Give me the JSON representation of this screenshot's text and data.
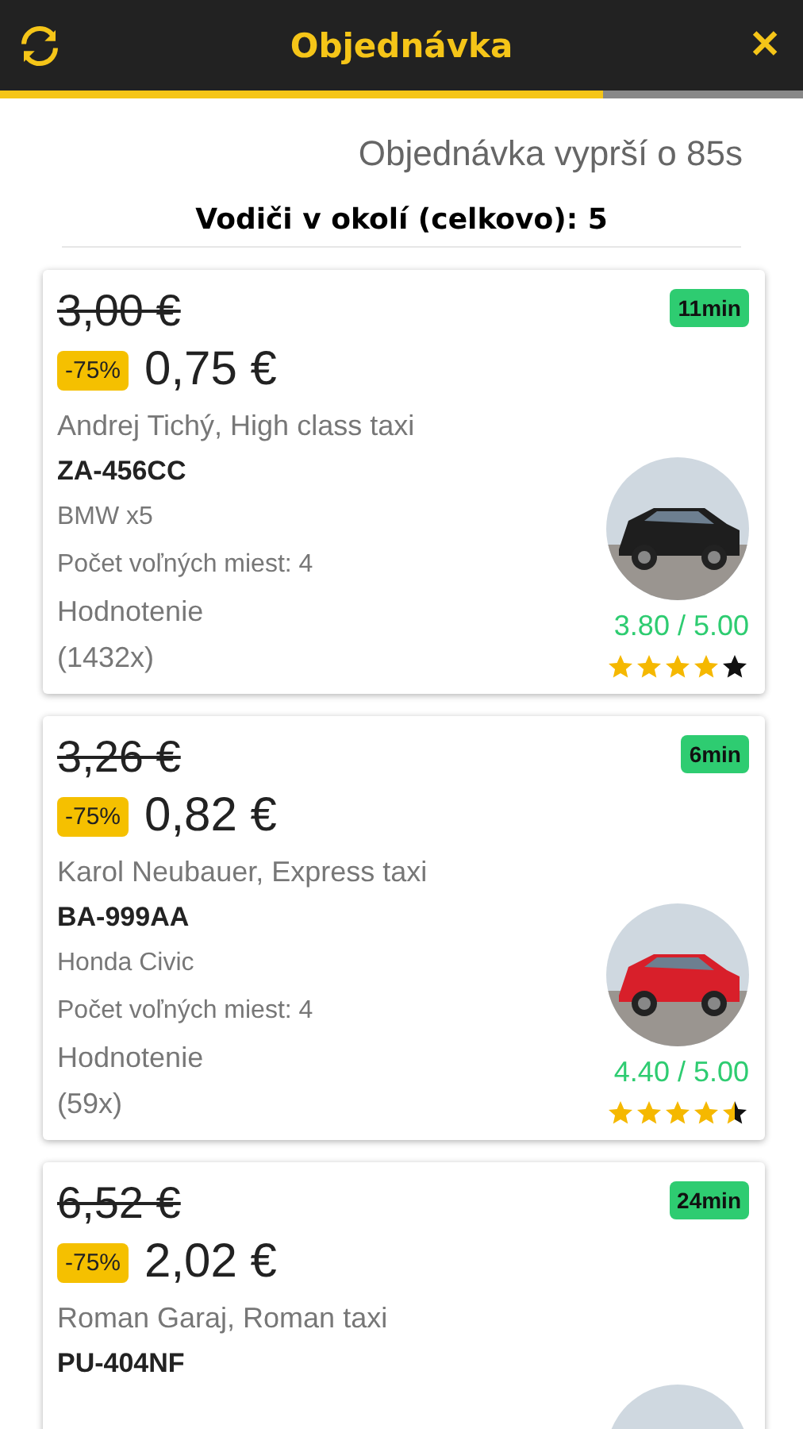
{
  "header": {
    "title": "Objednávka",
    "close": "✕",
    "progress": {
      "level": 0.75
    }
  },
  "expiry": "Objednávka vyprší o 85s",
  "drivers_heading": "Vodiči v okolí (celkovo): 5",
  "offers": [
    {
      "old_price": "3,00 €",
      "discount": "-75%",
      "price": "0,75 €",
      "eta": "11min",
      "driver": "Andrej Tichý, High class taxi",
      "plate": "ZA-456CC",
      "model": "BMW x5",
      "seats": "Počet voľných miest: 4",
      "rating_label": "Hodnotenie",
      "rating_count": "(1432x)",
      "rating": "3.80 / 5.00",
      "stars": 4
    },
    {
      "old_price": "3,26 €",
      "discount": "-75%",
      "price": "0,82 €",
      "eta": "6min",
      "driver": "Karol Neubauer, Express taxi",
      "plate": "BA-999AA",
      "model": "Honda Civic",
      "seats": "Počet voľných miest: 4",
      "rating_label": "Hodnotenie",
      "rating_count": "(59x)",
      "rating": "4.40 / 5.00",
      "stars": 4.5
    },
    {
      "old_price": "6,52 €",
      "discount": "-75%",
      "price": "2,02 €",
      "eta": "24min",
      "driver": "Roman Garaj, Roman taxi",
      "plate": "PU-404NF"
    }
  ]
}
